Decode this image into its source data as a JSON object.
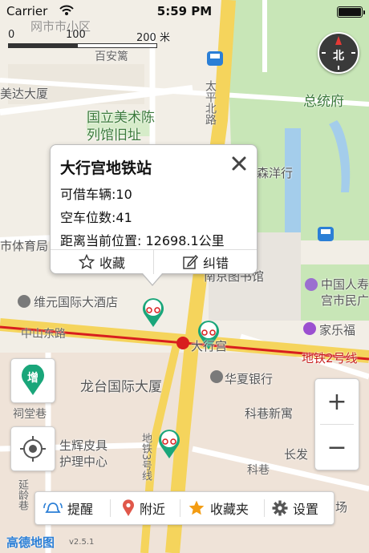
{
  "status_bar": {
    "carrier": "Carrier",
    "time": "5:59 PM"
  },
  "scale": {
    "label_0": "0",
    "label_1": "100",
    "label_2": "200 米"
  },
  "compass": {
    "label": "北"
  },
  "map_labels": {
    "top_cut": "网市市小区",
    "gaoanli": "百安篱",
    "meida": "美达大厦",
    "taiping": "太平北路",
    "museum_l1": "国立美术陈",
    "museum_l2": "列馆旧址",
    "president": "总统府",
    "senyang": "森洋行",
    "sports": "市体育局",
    "library": "南京图书馆",
    "people_l1": "中国人寿",
    "people_l2": "宫市民广",
    "weiyuan": "维元国际大酒店",
    "zhongshan": "中山东路",
    "daxinggong": "大行宫",
    "jiale": "家乐福",
    "metro2": "地铁2号线",
    "longtai": "龙台国际大厦",
    "huaxia": "华夏银行",
    "citang": "祠堂巷",
    "kexiang": "科巷新寓",
    "shenghui_l1": "生辉皮具",
    "shenghui_l2": "护理中心",
    "line3": "地铁3号线",
    "kexiang2": "科巷",
    "changfa": "长发",
    "yanling": "延龄巷",
    "square": "场"
  },
  "popup": {
    "title": "大行宫地铁站",
    "available": "可借车辆:10",
    "empty": "空车位数:41",
    "distance": "距离当前位置: 12698.1公里",
    "favorite": "收藏",
    "correct": "纠错"
  },
  "side": {
    "add_label": "增"
  },
  "zoom": {
    "in": "+",
    "out": "−"
  },
  "toolbar": {
    "remind": "提醒",
    "nearby": "附近",
    "favorites": "收藏夹",
    "settings": "设置"
  },
  "footer": {
    "logo": "高德地图",
    "version": "v2.5.1"
  },
  "colors": {
    "accent": "#1aa67a",
    "metro_red": "#d81e1e",
    "road_yellow": "#f5d45c"
  }
}
